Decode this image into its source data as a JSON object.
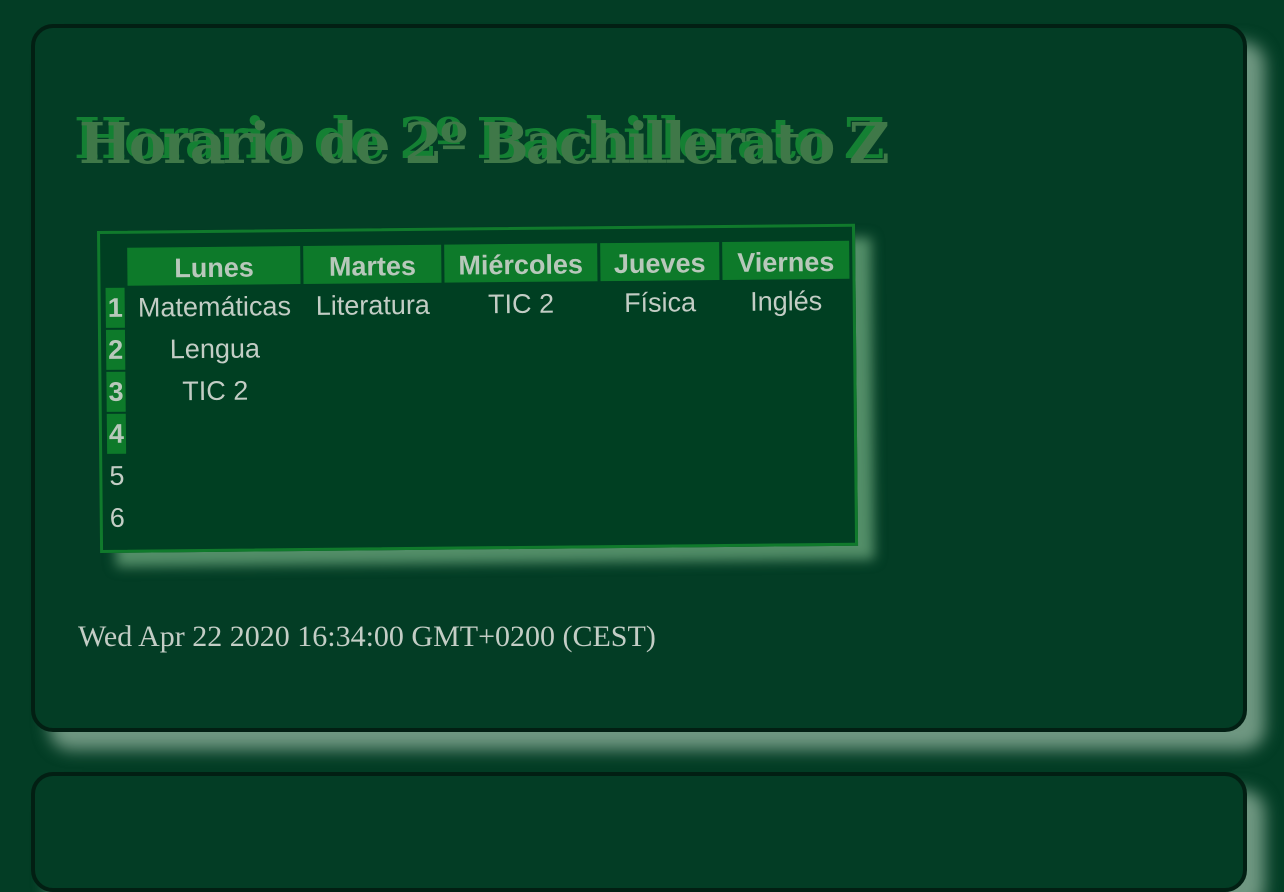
{
  "title": "Horario de 2º Bachillerato Z",
  "days": [
    "Lunes",
    "Martes",
    "Miércoles",
    "Jueves",
    "Viernes"
  ],
  "rows": [
    {
      "num": "1",
      "cells": [
        "Matemáticas",
        "Literatura",
        "TIC 2",
        "Física",
        "Inglés"
      ],
      "highlighted": true
    },
    {
      "num": "2",
      "cells": [
        "Lengua",
        "",
        "",
        "",
        ""
      ],
      "highlighted": true
    },
    {
      "num": "3",
      "cells": [
        "TIC 2",
        "",
        "",
        "",
        ""
      ],
      "highlighted": true
    },
    {
      "num": "4",
      "cells": [
        "",
        "",
        "",
        "",
        ""
      ],
      "highlighted": true
    },
    {
      "num": "5",
      "cells": [
        "",
        "",
        "",
        "",
        ""
      ],
      "highlighted": false
    },
    {
      "num": "6",
      "cells": [
        "",
        "",
        "",
        "",
        ""
      ],
      "highlighted": false
    }
  ],
  "date": "Wed Apr 22 2020 16:34:00 GMT+0200 (CEST)",
  "colors": {
    "background": "#033d25",
    "header_fill": "#0d7a2a",
    "title_shadow": "#148033",
    "text": "#c3cdc5"
  }
}
